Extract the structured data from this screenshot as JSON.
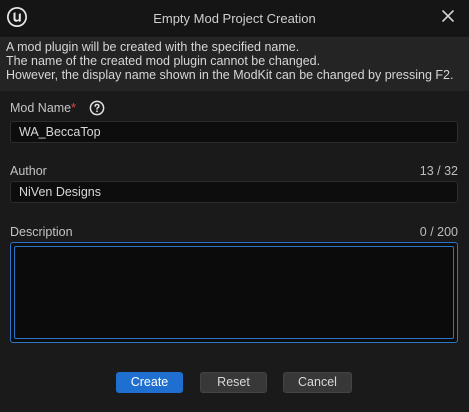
{
  "window": {
    "title": "Empty Mod Project Creation",
    "logo_icon": "unreal-logo-icon",
    "close_icon": "close-icon"
  },
  "info": {
    "line1": "A mod plugin will be created with the specified name.",
    "line2": "The name of the created mod plugin cannot be changed.",
    "line3": "However, the display name shown in the ModKit can be changed by pressing F2."
  },
  "mod_name": {
    "label": "Mod Name",
    "required_mark": "*",
    "help_icon": "question-circle-icon",
    "value": "WA_BeccaTop"
  },
  "author": {
    "label": "Author",
    "count": "13 / 32",
    "value": "NiVen Designs"
  },
  "description": {
    "label": "Description",
    "count": "0 / 200",
    "value": ""
  },
  "buttons": {
    "create": "Create",
    "reset": "Reset",
    "cancel": "Cancel"
  },
  "colors": {
    "accent": "#1f6fd0",
    "focus_border": "#2f73c9",
    "required": "#e04848"
  }
}
